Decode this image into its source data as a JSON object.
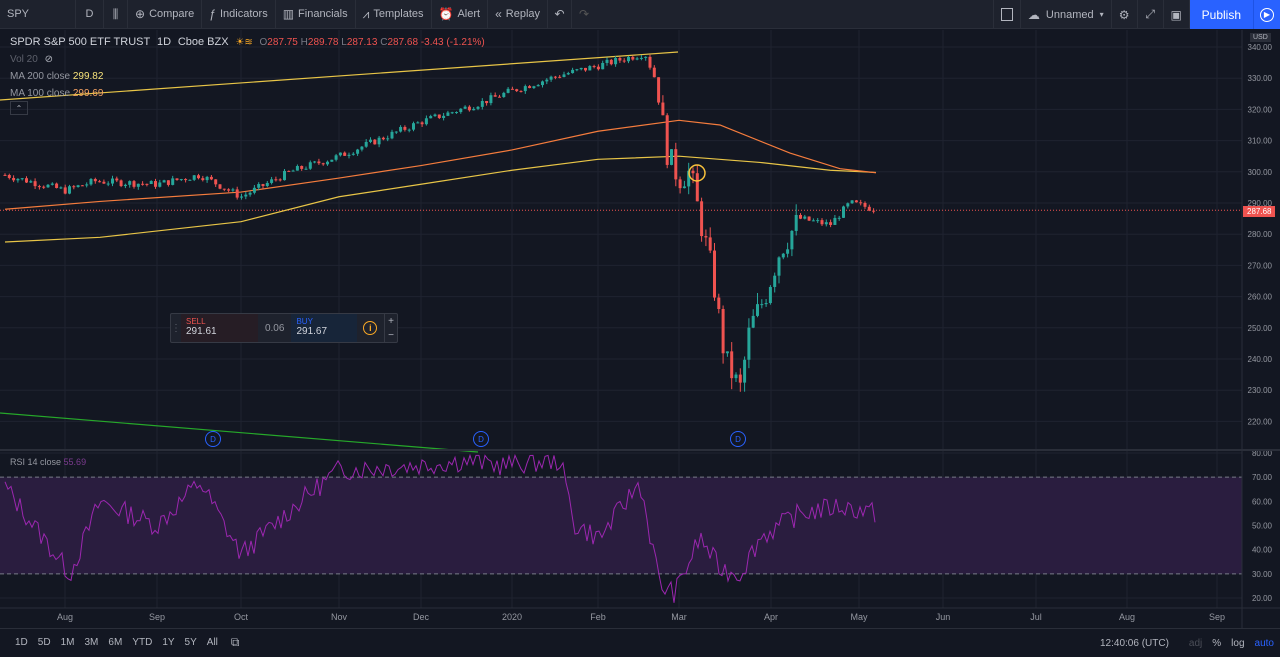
{
  "toolbar": {
    "symbol": "SPY",
    "interval": "D",
    "compare": "Compare",
    "indicators": "Indicators",
    "financials": "Financials",
    "templates": "Templates",
    "alert": "Alert",
    "replay": "Replay",
    "layout_name": "Unnamed",
    "publish": "Publish"
  },
  "legend": {
    "title": "SPDR S&P 500 ETF TRUST",
    "interval": "1D",
    "exchange": "Cboe BZX",
    "o_label": "O",
    "o": "287.75",
    "h_label": "H",
    "h": "289.78",
    "l_label": "L",
    "l": "287.13",
    "c_label": "C",
    "c": "287.68",
    "change": "-3.43 (-1.21%)",
    "vol": "Vol 20",
    "ma200_label": "MA 200 close",
    "ma200_value": "299.82",
    "ma100_label": "MA 100 close",
    "ma100_value": "299.69"
  },
  "trade": {
    "sell_label": "SELL",
    "sell_price": "291.61",
    "spread": "0.06",
    "buy_label": "BUY",
    "buy_price": "291.67"
  },
  "rsi": {
    "label": "RSI 14 close",
    "value": "55.69"
  },
  "axis": {
    "currency": "USD",
    "last_price": "287.68",
    "price_ticks": [
      "340.00",
      "330.00",
      "320.00",
      "310.00",
      "300.00",
      "290.00",
      "280.00",
      "270.00",
      "260.00",
      "250.00",
      "240.00",
      "230.00",
      "220.00"
    ],
    "rsi_ticks": [
      "80.00",
      "70.00",
      "60.00",
      "50.00",
      "40.00",
      "30.00",
      "20.00"
    ],
    "months": [
      "Aug",
      "Sep",
      "Oct",
      "Nov",
      "Dec",
      "2020",
      "Feb",
      "Mar",
      "Apr",
      "May",
      "Jun",
      "Jul",
      "Aug",
      "Sep"
    ]
  },
  "bottom": {
    "ranges": [
      "1D",
      "5D",
      "1M",
      "3M",
      "6M",
      "YTD",
      "1Y",
      "5Y",
      "All"
    ],
    "time": "12:40:06 (UTC)",
    "adj": "adj",
    "pct": "%",
    "log": "log",
    "auto": "auto"
  },
  "dividend_marker": "D",
  "colors": {
    "up": "#26a69a",
    "down": "#ef5350",
    "ma200": "#e8c547",
    "ma100": "#f57c3d",
    "rsi_line": "#9c27b0",
    "rsi_band": "#2a1d3f",
    "publish": "#2962ff"
  }
}
